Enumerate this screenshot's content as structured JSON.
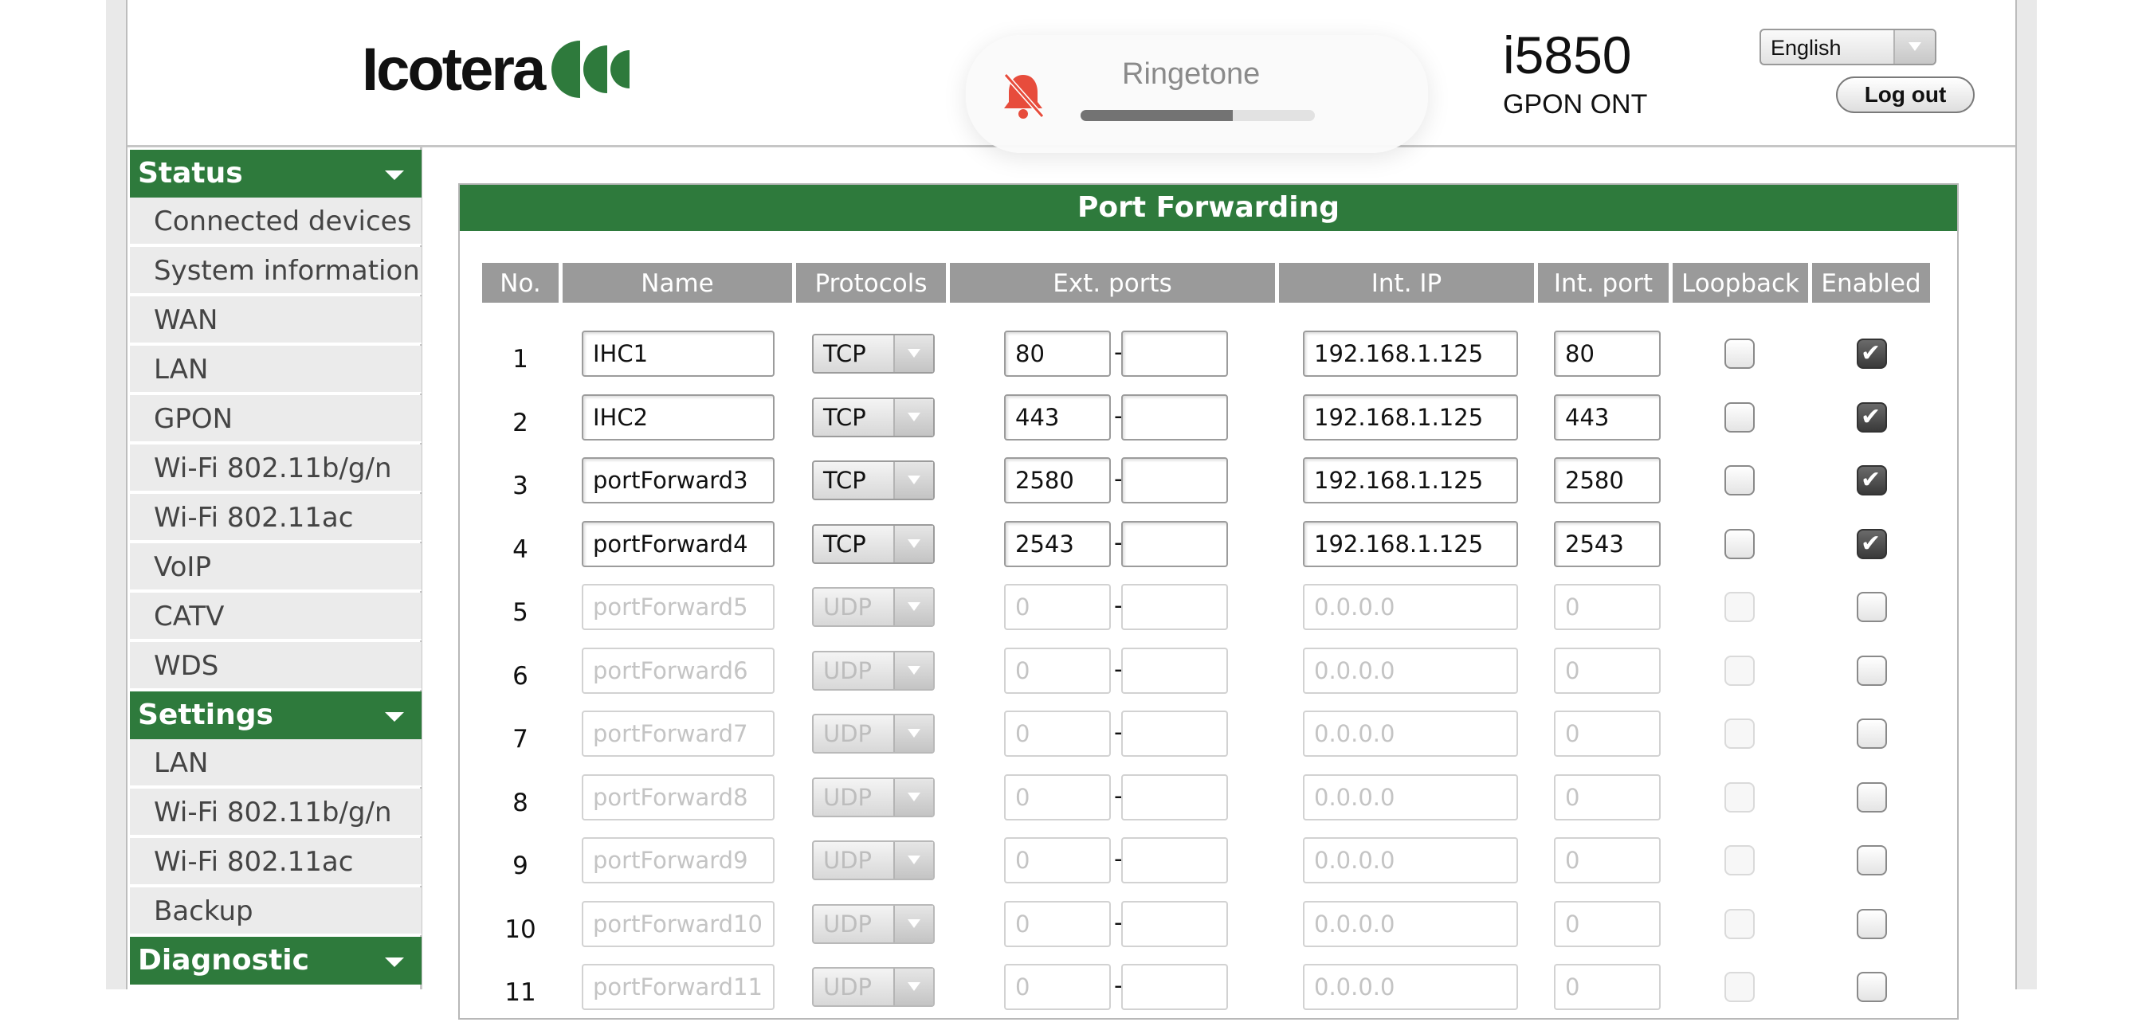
{
  "brand": {
    "logo_text": "Icotera"
  },
  "device": {
    "model": "i5850",
    "type": "GPON ONT"
  },
  "language": {
    "selected": "English"
  },
  "logout_label": "Log out",
  "overlay": {
    "title": "Ringetone",
    "volume_fraction": 0.65,
    "icon": "bell-muted-icon",
    "icon_color": "#e74c3c"
  },
  "sidebar": {
    "status": {
      "label": "Status",
      "items": [
        "Connected devices",
        "System information",
        "WAN",
        "LAN",
        "GPON",
        "Wi-Fi 802.11b/g/n",
        "Wi-Fi 802.11ac",
        "VoIP",
        "CATV",
        "WDS"
      ]
    },
    "settings": {
      "label": "Settings",
      "items": [
        "LAN",
        "Wi-Fi 802.11b/g/n",
        "Wi-Fi 802.11ac",
        "Backup"
      ]
    },
    "diagnostic": {
      "label": "Diagnostic"
    }
  },
  "panel": {
    "title": "Port Forwarding",
    "headers": {
      "no": "No.",
      "name": "Name",
      "protocols": "Protocols",
      "ext_ports": "Ext. ports",
      "int_ip": "Int. IP",
      "int_port": "Int. port",
      "loopback": "Loopback",
      "enabled": "Enabled"
    },
    "rows": [
      {
        "no": "1",
        "name": "IHC1",
        "protocol": "TCP",
        "ext_start": "80",
        "ext_end": "",
        "int_ip": "192.168.1.125",
        "int_port": "80",
        "loopback": false,
        "enabled": true
      },
      {
        "no": "2",
        "name": "IHC2",
        "protocol": "TCP",
        "ext_start": "443",
        "ext_end": "",
        "int_ip": "192.168.1.125",
        "int_port": "443",
        "loopback": false,
        "enabled": true
      },
      {
        "no": "3",
        "name": "portForward3",
        "protocol": "TCP",
        "ext_start": "2580",
        "ext_end": "",
        "int_ip": "192.168.1.125",
        "int_port": "2580",
        "loopback": false,
        "enabled": true
      },
      {
        "no": "4",
        "name": "portForward4",
        "protocol": "TCP",
        "ext_start": "2543",
        "ext_end": "",
        "int_ip": "192.168.1.125",
        "int_port": "2543",
        "loopback": false,
        "enabled": true
      },
      {
        "no": "5",
        "name": "portForward5",
        "protocol": "UDP",
        "ext_start": "0",
        "ext_end": "",
        "int_ip": "0.0.0.0",
        "int_port": "0",
        "loopback": false,
        "enabled": false
      },
      {
        "no": "6",
        "name": "portForward6",
        "protocol": "UDP",
        "ext_start": "0",
        "ext_end": "",
        "int_ip": "0.0.0.0",
        "int_port": "0",
        "loopback": false,
        "enabled": false
      },
      {
        "no": "7",
        "name": "portForward7",
        "protocol": "UDP",
        "ext_start": "0",
        "ext_end": "",
        "int_ip": "0.0.0.0",
        "int_port": "0",
        "loopback": false,
        "enabled": false
      },
      {
        "no": "8",
        "name": "portForward8",
        "protocol": "UDP",
        "ext_start": "0",
        "ext_end": "",
        "int_ip": "0.0.0.0",
        "int_port": "0",
        "loopback": false,
        "enabled": false
      },
      {
        "no": "9",
        "name": "portForward9",
        "protocol": "UDP",
        "ext_start": "0",
        "ext_end": "",
        "int_ip": "0.0.0.0",
        "int_port": "0",
        "loopback": false,
        "enabled": false
      },
      {
        "no": "10",
        "name": "portForward10",
        "protocol": "UDP",
        "ext_start": "0",
        "ext_end": "",
        "int_ip": "0.0.0.0",
        "int_port": "0",
        "loopback": false,
        "enabled": false
      },
      {
        "no": "11",
        "name": "portForward11",
        "protocol": "UDP",
        "ext_start": "0",
        "ext_end": "",
        "int_ip": "0.0.0.0",
        "int_port": "0",
        "loopback": false,
        "enabled": false
      }
    ]
  },
  "colors": {
    "brand_green": "#2e7a3c",
    "header_gray": "#9a9a9a",
    "alert_red": "#e74c3c"
  }
}
